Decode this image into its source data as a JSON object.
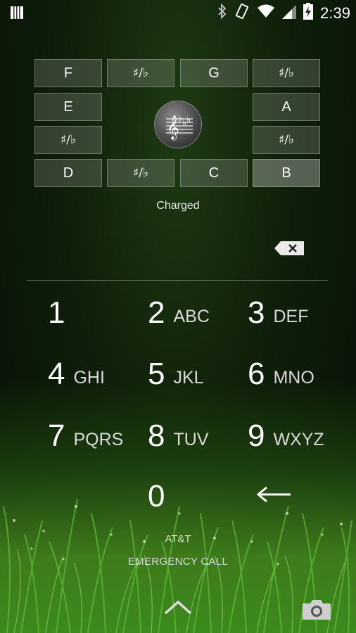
{
  "status_bar": {
    "time": "2:39",
    "icons": [
      "notes-icon",
      "bluetooth-icon",
      "vibrate-icon",
      "wifi-icon",
      "signal-icon",
      "battery-charging-icon"
    ]
  },
  "music_keys": {
    "row1": [
      "F",
      "♯/♭",
      "G",
      "♯/♭"
    ],
    "row2_left": "E",
    "row2_right": "A",
    "row3_left": "♯/♭",
    "row3_right": "♯/♭",
    "row4": [
      "D",
      "♯/♭",
      "C",
      "B"
    ],
    "center_icon": "treble-clef-icon"
  },
  "battery_status": "Charged",
  "dialpad": [
    {
      "digit": "1",
      "letters": ""
    },
    {
      "digit": "2",
      "letters": "ABC"
    },
    {
      "digit": "3",
      "letters": "DEF"
    },
    {
      "digit": "4",
      "letters": "GHI"
    },
    {
      "digit": "5",
      "letters": "JKL"
    },
    {
      "digit": "6",
      "letters": "MNO"
    },
    {
      "digit": "7",
      "letters": "PQRS"
    },
    {
      "digit": "8",
      "letters": "TUV"
    },
    {
      "digit": "9",
      "letters": "WXYZ"
    },
    {
      "digit": "0",
      "letters": ""
    }
  ],
  "carrier": "AT&T",
  "emergency_call": "EMERGENCY CALL"
}
